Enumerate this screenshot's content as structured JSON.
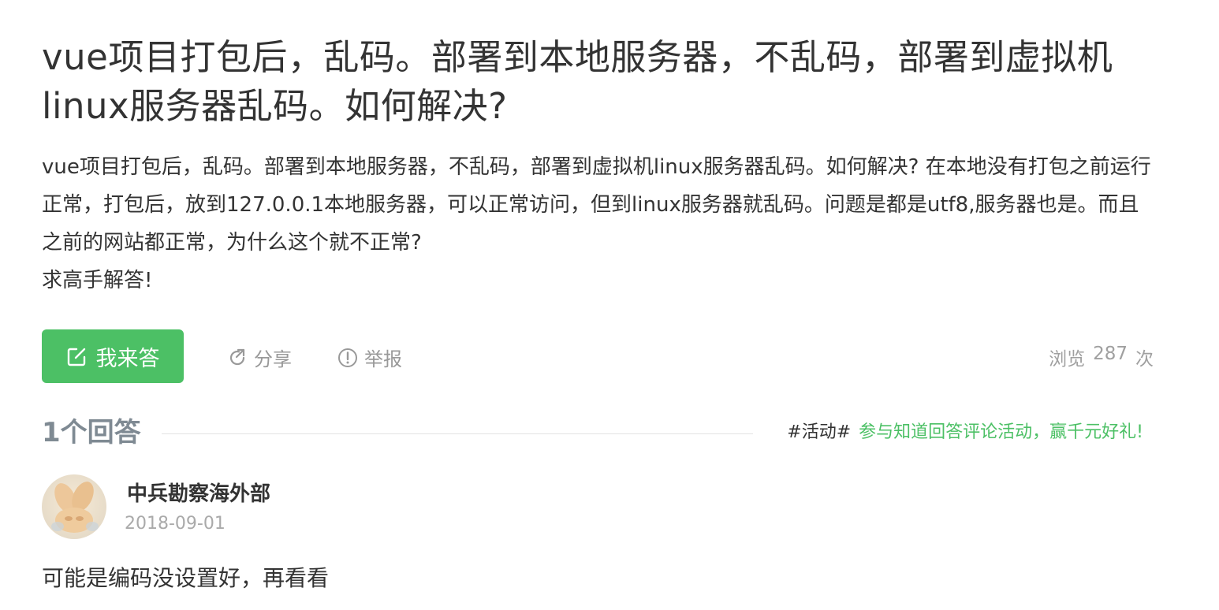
{
  "question": {
    "title": "vue项目打包后，乱码。部署到本地服务器，不乱码，部署到虚拟机linux服务器乱码。如何解决?",
    "body_paragraphs": [
      "vue项目打包后，乱码。部署到本地服务器，不乱码，部署到虚拟机linux服务器乱码。如何解决? 在本地没有打包之前运行正常，打包后，放到127.0.0.1本地服务器，可以正常访问，但到linux服务器就乱码。问题是都是utf8,服务器也是。而且之前的网站都正常，为什么这个就不正常?",
      "求高手解答!"
    ]
  },
  "actions": {
    "answer_label": "我来答",
    "share_label": "分享",
    "report_label": "举报",
    "views_prefix": "浏览",
    "views_count": "287",
    "views_suffix": "次"
  },
  "answers": {
    "count_label": "1个回答",
    "promo_tag": "#活动#",
    "promo_text": "参与知道回答评论活动，赢千元好礼!",
    "items": [
      {
        "author": "中兵勘察海外部",
        "date": "2018-09-01",
        "content": "可能是编码没设置好，再看看"
      }
    ]
  },
  "icons": {
    "answer": "edit-icon",
    "share": "share-icon",
    "report": "report-icon"
  },
  "colors": {
    "accent_green": "#4cc065",
    "muted_gray": "#999999",
    "answers_count_gray": "#7f8a93"
  }
}
